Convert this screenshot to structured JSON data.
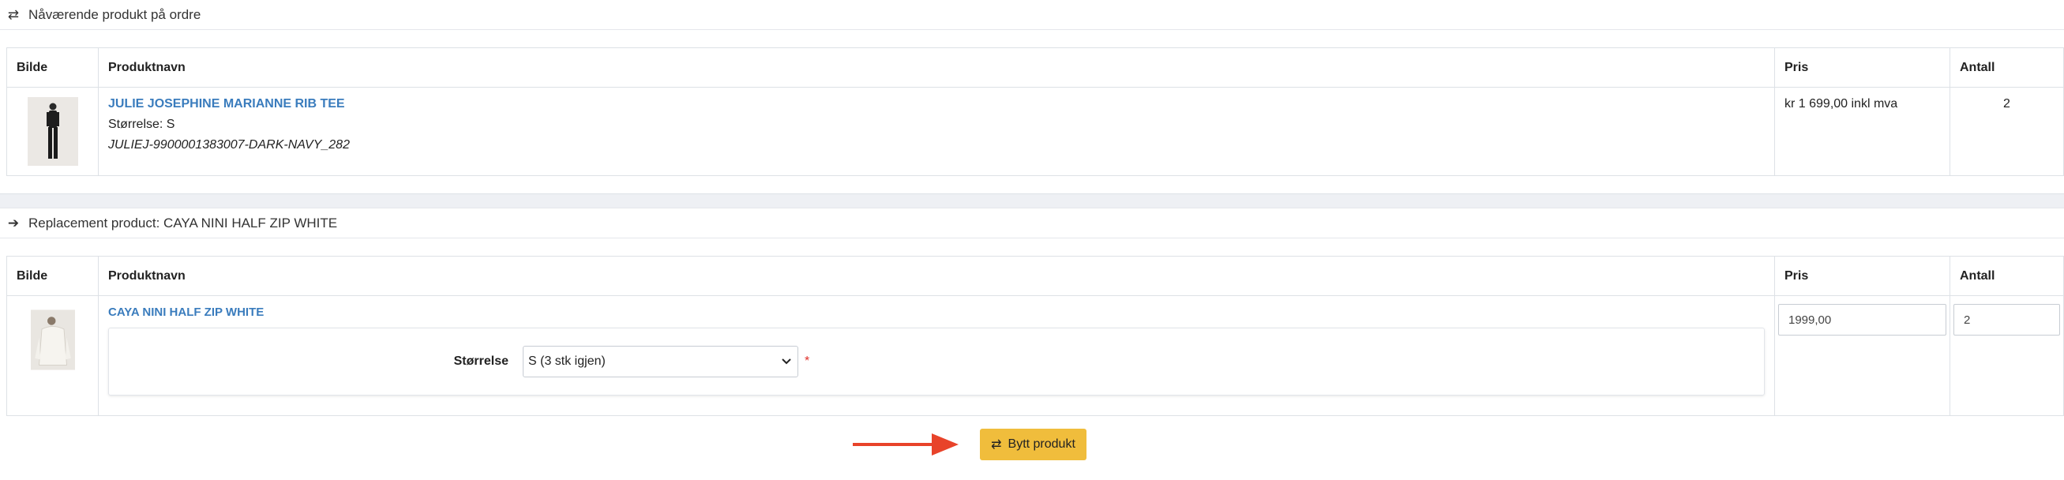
{
  "current_section": {
    "icon": "swap-arrows-icon",
    "title": "Nåværende produkt på ordre",
    "headers": {
      "image": "Bilde",
      "name": "Produktnavn",
      "price": "Pris",
      "qty": "Antall"
    },
    "product": {
      "name": "JULIE JOSEPHINE MARIANNE RIB TEE",
      "size_line": "Størrelse: S",
      "sku": "JULIEJ-9900001383007-DARK-NAVY_282",
      "price": "kr 1 699,00 inkl mva",
      "qty": "2"
    }
  },
  "replacement_section": {
    "icon": "arrow-right-icon",
    "title": "Replacement product: CAYA NINI HALF ZIP WHITE",
    "headers": {
      "image": "Bilde",
      "name": "Produktnavn",
      "price": "Pris",
      "qty": "Antall"
    },
    "product": {
      "name": "CAYA NINI HALF ZIP WHITE",
      "size_label": "Størrelse",
      "size_selected": "S (3 stk igjen)",
      "required_marker": "*",
      "price_value": "1999,00",
      "qty_value": "2"
    }
  },
  "actions": {
    "swap_label": "Bytt produkt",
    "swap_icon": "swap-arrows-icon",
    "accent_color": "#f0bd3c",
    "annotation_arrow_color": "#e8432a"
  }
}
